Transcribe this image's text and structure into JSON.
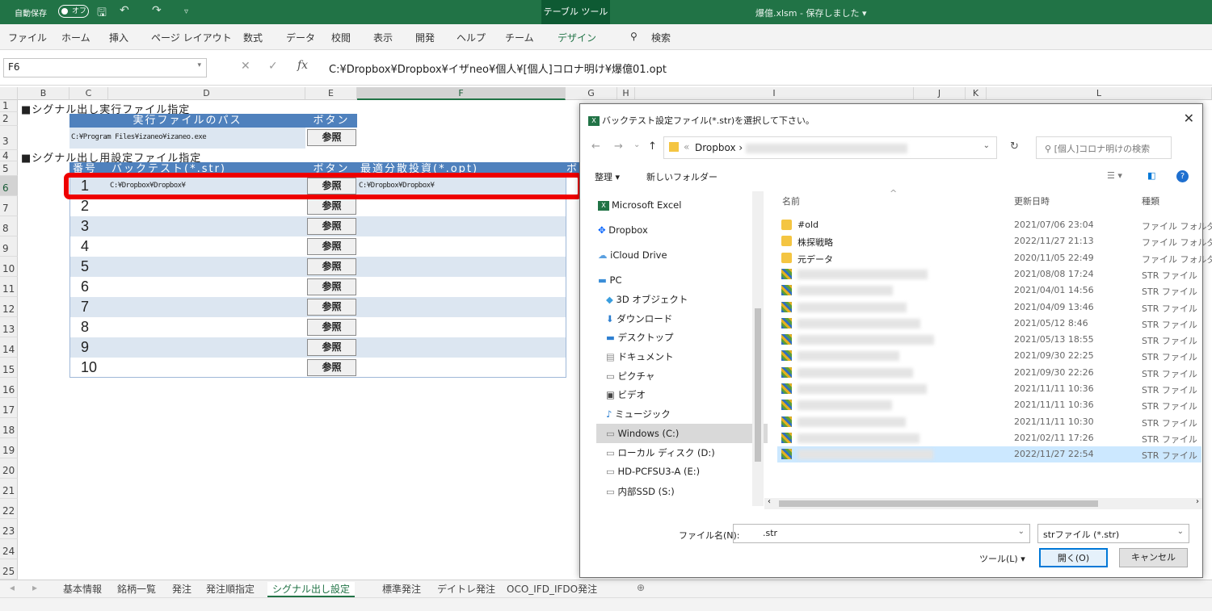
{
  "titlebar": {
    "autosave_label": "自動保存",
    "autosave_state": "オフ",
    "save": "🖫",
    "undo": "↶",
    "redo": "↷",
    "customize": "▿",
    "context_tab": "テーブル ツール",
    "document": "爆億.xlsm - 保存しました ▾"
  },
  "ribbon": {
    "tabs": [
      "ファイル",
      "ホーム",
      "挿入",
      "ページ レイアウト",
      "数式",
      "データ",
      "校閲",
      "表示",
      "開発",
      "ヘルプ",
      "チーム",
      "デザイン"
    ],
    "search": "検索"
  },
  "formula": {
    "name_box": "F6",
    "cancel": "✕",
    "enter": "✓",
    "fx": "fx",
    "value": "C:¥Dropbox¥Dropbox¥イザneo¥個人¥[個人]コロナ明け¥爆億01.opt"
  },
  "sheet": {
    "columns": [
      "B",
      "C",
      "D",
      "E",
      "F",
      "G",
      "H",
      "I",
      "J",
      "K",
      "L"
    ],
    "rows": [
      "1",
      "2",
      "3",
      "4",
      "5",
      "6",
      "7",
      "8",
      "9",
      "10",
      "11",
      "12",
      "13",
      "14",
      "15",
      "16",
      "17",
      "18",
      "19",
      "20",
      "21",
      "22",
      "23",
      "24",
      "25"
    ],
    "section1": "■シグナル出し実行ファイル指定",
    "exec_path_header": "実行ファイルのパス",
    "button_header": "ボタン",
    "exec_path": "C:¥Program Files¥izaneo¥izaneo.exe",
    "browse": "参照",
    "section2": "■シグナル出し用設定ファイル指定",
    "table_headers": {
      "no": "番号",
      "backtest": "バックテスト(*.str)",
      "button": "ボタン",
      "optimize": "最適分散投資(*.opt)",
      "extra": "ボ"
    },
    "row1_backtest": "C:¥Dropbox¥Dropbox¥",
    "row1_opt": "C:¥Dropbox¥Dropbox¥",
    "numbers": [
      "1",
      "2",
      "3",
      "4",
      "5",
      "6",
      "7",
      "8",
      "9",
      "10"
    ]
  },
  "sheet_tabs": [
    "基本情報",
    "銘柄一覧",
    "発注",
    "発注順指定",
    "シグナル出し設定",
    "",
    "標準発注",
    "デイトレ発注",
    "OCO_IFD_IFDO発注"
  ],
  "dialog": {
    "title": "バックテスト設定ファイル(*.str)を選択して下さい。",
    "close": "✕",
    "back": "←",
    "forward": "→",
    "recent": "⌄",
    "up": "↑",
    "path": "Dropbox ›",
    "refresh": "↻",
    "search_placeholder": "[個人]コロナ明けの検索",
    "organize": "整理 ▾",
    "new_folder": "新しいフォルダー",
    "nav_items": [
      "Microsoft Excel",
      "Dropbox",
      "iCloud Drive",
      "PC",
      "3D オブジェクト",
      "ダウンロード",
      "デスクトップ",
      "ドキュメント",
      "ピクチャ",
      "ビデオ",
      "ミュージック",
      "Windows (C:)",
      "ローカル ディスク (D:)",
      "HD-PCFSU3-A (E:)",
      "内部SSD (S:)"
    ],
    "columns": {
      "name": "名前",
      "date": "更新日時",
      "type": "種類"
    },
    "files": [
      {
        "name": "#old",
        "date": "2021/07/06 23:04",
        "type": "ファイル フォルダー",
        "kind": "folder"
      },
      {
        "name": "株探戦略",
        "date": "2022/11/27 21:13",
        "type": "ファイル フォルダー",
        "kind": "folder"
      },
      {
        "name": "元データ",
        "date": "2020/11/05 22:49",
        "type": "ファイル フォルダー",
        "kind": "folder"
      },
      {
        "name": "",
        "date": "2021/08/08 17:24",
        "type": "STR ファイル",
        "kind": "str"
      },
      {
        "name": "",
        "date": "2021/04/01 14:56",
        "type": "STR ファイル",
        "kind": "str"
      },
      {
        "name": "",
        "date": "2021/04/09 13:46",
        "type": "STR ファイル",
        "kind": "str"
      },
      {
        "name": "",
        "date": "2021/05/12 8:46",
        "type": "STR ファイル",
        "kind": "str"
      },
      {
        "name": "",
        "date": "2021/05/13 18:55",
        "type": "STR ファイル",
        "kind": "str"
      },
      {
        "name": "",
        "date": "2021/09/30 22:25",
        "type": "STR ファイル",
        "kind": "str"
      },
      {
        "name": "",
        "date": "2021/09/30 22:26",
        "type": "STR ファイル",
        "kind": "str"
      },
      {
        "name": "",
        "date": "2021/11/11 10:36",
        "type": "STR ファイル",
        "kind": "str"
      },
      {
        "name": "",
        "date": "2021/11/11 10:36",
        "type": "STR ファイル",
        "kind": "str"
      },
      {
        "name": "",
        "date": "2021/11/11 10:30",
        "type": "STR ファイル",
        "kind": "str"
      },
      {
        "name": "",
        "date": "2021/02/11 17:26",
        "type": "STR ファイル",
        "kind": "str"
      },
      {
        "name": "",
        "date": "2022/11/27 22:54",
        "type": "STR ファイル",
        "kind": "str"
      }
    ],
    "filename_label": "ファイル名(N):",
    "filename_value": ".str",
    "filter": "strファイル (*.str)",
    "tools": "ツール(L) ▾",
    "open": "開く(O)",
    "cancel": "キャンセル"
  }
}
